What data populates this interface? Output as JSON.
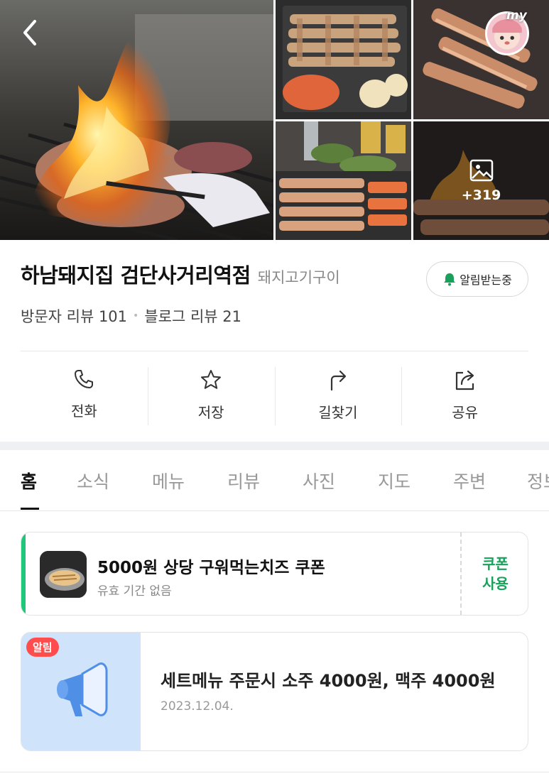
{
  "gallery": {
    "more_count": "+319",
    "avatar_tag": "my"
  },
  "place": {
    "name": "하남돼지집 검단사거리역점",
    "category": "돼지고기구이",
    "alert_label": "알림받는중",
    "visitor_reviews": "방문자 리뷰 101",
    "blog_reviews": "블로그 리뷰 21"
  },
  "actions": [
    {
      "label": "전화",
      "icon": "phone-icon"
    },
    {
      "label": "저장",
      "icon": "star-icon"
    },
    {
      "label": "길찾기",
      "icon": "directions-icon"
    },
    {
      "label": "공유",
      "icon": "share-icon"
    }
  ],
  "tabs": [
    "홈",
    "소식",
    "메뉴",
    "리뷰",
    "사진",
    "지도",
    "주변",
    "정보"
  ],
  "coupon": {
    "title": "5000원 상당 구워먹는치즈 쿠폰",
    "subtitle": "유효 기간 없음",
    "use_line1": "쿠폰",
    "use_line2": "사용"
  },
  "notice": {
    "badge": "알림",
    "title": "세트메뉴 주문시 소주 4000원, 맥주 4000원",
    "date": "2023.12.04."
  },
  "colors": {
    "accent_green": "#1fc77a",
    "badge_red": "#ff4d4d",
    "notice_bg": "#cfe3fa"
  }
}
